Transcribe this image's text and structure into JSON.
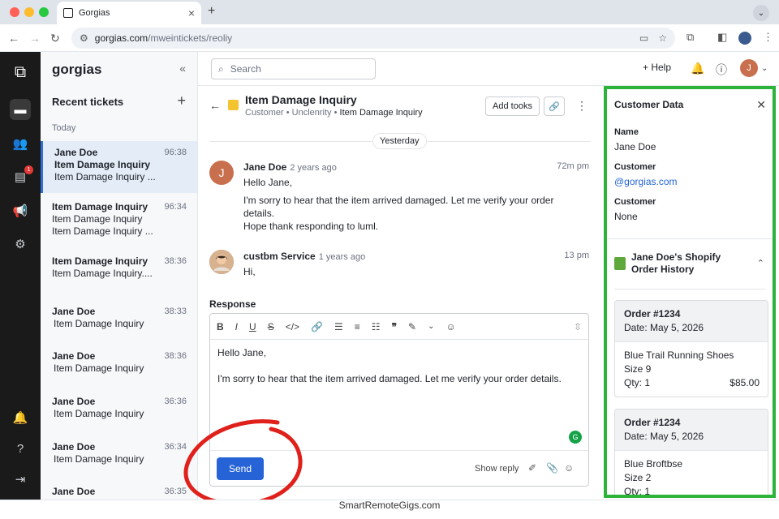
{
  "browser": {
    "tab_title": "Gorgias",
    "url_host": "gorgias.com",
    "url_path": "/mweintickets/reoliy"
  },
  "sidebar": {
    "brand": "gorgias",
    "recent_label": "Recent tickets",
    "today_label": "Today",
    "badge": "1",
    "tickets": [
      {
        "line1": "Jane Doe",
        "line2": "Item Damage Inquiry",
        "line3": "Item Damage Inquiry ...",
        "time": "96:38"
      },
      {
        "line1": "Item Damage Inquiry",
        "line2": "Item Damage Inquiry",
        "line3": "Item Damage Inquiry ...",
        "time": "96:34"
      },
      {
        "line1": "Item Damage Inquiry",
        "line2": "Item Damage Inquiry....",
        "line3": "",
        "time": "38:36"
      },
      {
        "line1": "Jane Doe",
        "line2": "Item Damage Inquiry",
        "line3": "",
        "time": "38:33"
      },
      {
        "line1": "Jane Doe",
        "line2": "Item Damage Inquiry",
        "line3": "",
        "time": "38:36"
      },
      {
        "line1": "Jane Doe",
        "line2": "Item Damage Inquiry",
        "line3": "",
        "time": "36:36"
      },
      {
        "line1": "Jane Doe",
        "line2": "Item Damage Inquiry",
        "line3": "",
        "time": "36:34"
      },
      {
        "line1": "Jane Doe",
        "line2": "",
        "line3": "",
        "time": "36:35"
      }
    ]
  },
  "topbar": {
    "search_placeholder": "Search",
    "help_label": "+ Help",
    "user_initial": "J"
  },
  "ticket": {
    "title": "Item Damage Inquiry",
    "crumb1": "Customer",
    "crumb2": "Unclenrity",
    "crumb3": "Item Damage Inquiry",
    "add_tools": "Add tooks",
    "day_divider": "Yesterday",
    "messages": [
      {
        "initial": "J",
        "from": "Jane Doe",
        "ago": "2 years ago",
        "time": "72m pm",
        "l1": "Hello Jane,",
        "l2": "I'm sorry to hear that the item arrived damaged. Let me verify your order details.",
        "l3": "Hope thank responding to luml."
      },
      {
        "from": "custbm Service",
        "ago": "1 years ago",
        "time": "13 pm",
        "l1": "Hi,"
      }
    ],
    "response_label": "Response",
    "draft_line1": "Hello Jane,",
    "draft_line2": "I'm sorry to hear that the item arrived damaged. Let me verify your order details.",
    "send_label": "Send",
    "show_reply": "Show reply"
  },
  "customer": {
    "panel_title": "Customer Data",
    "name_label": "Name",
    "name_value": "Jane Doe",
    "email_label": "Customer",
    "email_value": "@gorgias.com",
    "other_label": "Customer",
    "other_value": "None",
    "shopify_title": "Jane Doe's Shopify Order History",
    "orders": [
      {
        "number": "Order #1234",
        "date": "Date: May 5, 2026",
        "item": "Blue Trail Running Shoes",
        "size": "Size 9",
        "qty": "Qty: 1",
        "price": "$85.00"
      },
      {
        "number": "Order #1234",
        "date": "Date: May 5, 2026",
        "item": "Blue Broftbse",
        "size": "Size 2",
        "qty": "Qty: 1",
        "price": ""
      }
    ]
  },
  "watermark": "SmartRemoteGigs.com",
  "colors": {
    "accent": "#2563d6",
    "highlight": "#2bb33a",
    "annotation": "#e0201b",
    "sidebar": "#1a1a1a"
  }
}
